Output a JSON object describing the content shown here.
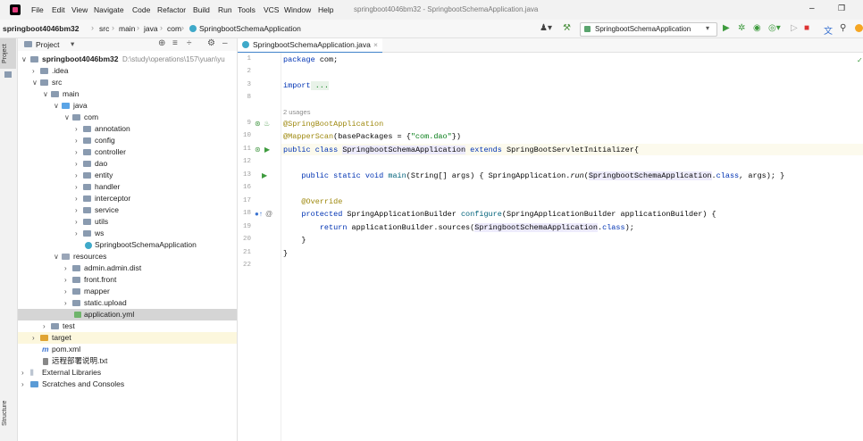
{
  "menu": {
    "items": [
      "File",
      "Edit",
      "View",
      "Navigate",
      "Code",
      "Refactor",
      "Build",
      "Run",
      "Tools",
      "VCS",
      "Window",
      "Help"
    ],
    "window_title": "springboot4046bm32 - SpringbootSchemaApplication.java"
  },
  "navbar": {
    "crumbs": [
      "springboot4046bm32",
      "src",
      "main",
      "java",
      "com",
      "SpringbootSchemaApplication"
    ],
    "run_config": "SpringbootSchemaApplication"
  },
  "leftstrip": {
    "project_tab": "Project",
    "structure_tab": "Structure"
  },
  "project": {
    "title": "Project",
    "root_name": "springboot4046bm32",
    "root_path": "D:\\study\\operations\\157\\yuan\\yu",
    "tree": [
      {
        "label": ".idea"
      },
      {
        "label": "src"
      },
      {
        "label": "main"
      },
      {
        "label": "java"
      },
      {
        "label": "com"
      },
      {
        "label": "annotation"
      },
      {
        "label": "config"
      },
      {
        "label": "controller"
      },
      {
        "label": "dao"
      },
      {
        "label": "entity"
      },
      {
        "label": "handler"
      },
      {
        "label": "interceptor"
      },
      {
        "label": "service"
      },
      {
        "label": "utils"
      },
      {
        "label": "ws"
      },
      {
        "label": "SpringbootSchemaApplication"
      },
      {
        "label": "resources"
      },
      {
        "label": "admin.admin.dist"
      },
      {
        "label": "front.front"
      },
      {
        "label": "mapper"
      },
      {
        "label": "static.upload"
      },
      {
        "label": "application.yml"
      },
      {
        "label": "test"
      },
      {
        "label": "target"
      },
      {
        "label": "pom.xml"
      },
      {
        "label": "远程部署说明.txt"
      },
      {
        "label": "External Libraries"
      },
      {
        "label": "Scratches and Consoles"
      }
    ]
  },
  "editor": {
    "tab_label": "SpringbootSchemaApplication.java",
    "line_numbers": [
      "1",
      "2",
      "3",
      "8",
      "9",
      "10",
      "11",
      "12",
      "13",
      "16",
      "17",
      "18",
      "19",
      "20",
      "21",
      "22"
    ],
    "usages": "2 usages",
    "code": {
      "l1_kw": "package",
      "l1_rest": " com;",
      "l3_kw": "import",
      "l3_rest": " ...",
      "l9": "@SpringBootApplication",
      "l10_an": "@MapperScan",
      "l10_a": "(basePackages = {",
      "l10_str": "\"com.dao\"",
      "l10_b": "})",
      "l11_kw1": "public class",
      "l11_cls": "SpringbootSchemaApplication",
      "l11_kw2": "extends",
      "l11_rest": "SpringBootServletInitializer{",
      "l13_kw": "public static void",
      "l13_mth": "main",
      "l13_a": "(String[] args) { SpringApplication.",
      "l13_run": "run",
      "l13_b": "(",
      "l13_cls": "SpringbootSchemaApplication",
      "l13_c": ".",
      "l13_kw2": "class",
      "l13_d": ", args); }",
      "l17": "@Override",
      "l18_kw": "protected",
      "l18_rest": " SpringApplicationBuilder ",
      "l18_mth": "configure",
      "l18_b": "(SpringApplicationBuilder applicationBuilder) {",
      "l19_kw": "return",
      "l19_a": " applicationBuilder.sources(",
      "l19_cls": "SpringbootSchemaApplication",
      "l19_b": ".",
      "l19_kw2": "class",
      "l19_c": ");",
      "l20": "}",
      "l21": "}"
    }
  }
}
